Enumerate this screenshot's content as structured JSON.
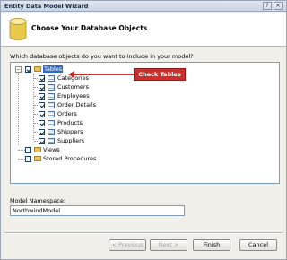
{
  "window": {
    "title": "Entity Data Model Wizard"
  },
  "header": {
    "title": "Choose Your Database Objects"
  },
  "question": "Which database objects do you want to include in your model?",
  "tree": {
    "root": {
      "label": "Tables",
      "checked": true,
      "expanded": true
    },
    "tables": [
      "Categories",
      "Customers",
      "Employees",
      "Order Details",
      "Orders",
      "Products",
      "Shippers",
      "Suppliers"
    ],
    "views": {
      "label": "Views",
      "checked": false
    },
    "procs": {
      "label": "Stored Procedures",
      "checked": false
    }
  },
  "callout": {
    "text": "Check Tables",
    "color": "#c9302c"
  },
  "namespace": {
    "label": "Model Namespace:",
    "value": "NorthwindModel"
  },
  "buttons": {
    "previous": "< Previous",
    "next": "Next >",
    "finish": "Finish",
    "cancel": "Cancel"
  },
  "icons": {
    "minimize": "minimize-icon",
    "close": "close-icon",
    "database": "database-icon"
  }
}
